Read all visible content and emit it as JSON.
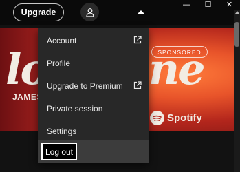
{
  "topbar": {
    "upgrade_label": "Upgrade"
  },
  "window_controls": {
    "minimize": "—",
    "maximize": "☐",
    "close": "✕"
  },
  "banner": {
    "word_left": "lo",
    "word_right": "ne",
    "artist": "JAMES F",
    "sponsored_label": "SPONSORED",
    "brand": "Spotify"
  },
  "menu": {
    "items": [
      {
        "label": "Account",
        "icon": "external-link-icon"
      },
      {
        "label": "Profile"
      },
      {
        "label": "Upgrade to Premium",
        "icon": "external-link-icon"
      },
      {
        "label": "Private session"
      },
      {
        "label": "Settings"
      },
      {
        "label": "Log out"
      }
    ]
  }
}
